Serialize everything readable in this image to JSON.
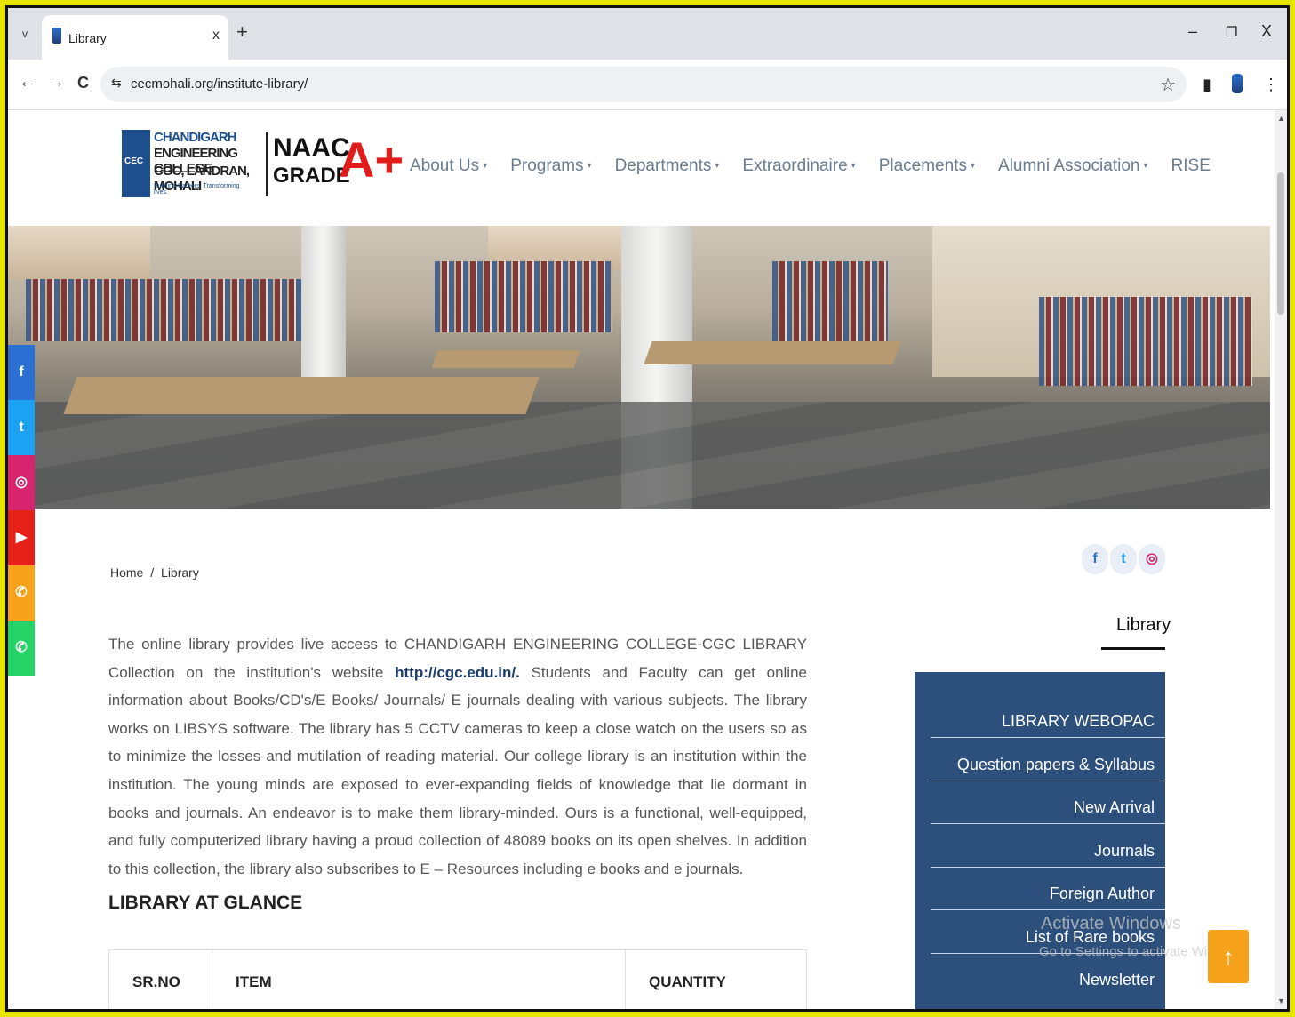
{
  "browser": {
    "tab_title": "Library",
    "tab_close": "x",
    "new_tab": "+",
    "tab_menu": "v",
    "minimize": "–",
    "restore": "❐",
    "close": "X",
    "back": "←",
    "forward": "→",
    "reload": "C",
    "url": "cecmohali.org/institute-library/",
    "site_info_icon": "⇆",
    "star_icon": "☆",
    "side_panel_icon": "▮",
    "menu_icon": "⋮"
  },
  "header": {
    "logo": {
      "line1": "CHANDIGARH",
      "line2": "ENGINEERING COLLEGE",
      "line3": "CGC, LANDRAN, MOHALI",
      "tagline": "Building Careers. Transforming lives.",
      "emblem_text": "CEC"
    },
    "naac": "NAAC",
    "grade": "GRADE",
    "aplus": "A+",
    "nav": [
      {
        "label": "About Us",
        "caret": "▾"
      },
      {
        "label": "Programs",
        "caret": "▾"
      },
      {
        "label": "Departments",
        "caret": "▾"
      },
      {
        "label": "Extraordinaire",
        "caret": "▾"
      },
      {
        "label": "Placements",
        "caret": "▾"
      },
      {
        "label": "Alumni Association",
        "caret": "▾"
      },
      {
        "label": "RISE",
        "caret": ""
      }
    ]
  },
  "social_sidebar": [
    {
      "name": "facebook",
      "glyph": "f",
      "color": "#2a6fd1"
    },
    {
      "name": "twitter",
      "glyph": "t",
      "color": "#1da1f2"
    },
    {
      "name": "instagram",
      "glyph": "◎",
      "color": "#d6246e"
    },
    {
      "name": "youtube",
      "glyph": "▶",
      "color": "#e62117"
    },
    {
      "name": "phone",
      "glyph": "✆",
      "color": "#f7a21b"
    },
    {
      "name": "whatsapp",
      "glyph": "✆",
      "color": "#25d366"
    }
  ],
  "breadcrumb": {
    "home": "Home",
    "sep": "/",
    "current": "Library"
  },
  "intro": {
    "part1": "The online library provides live access to CHANDIGARH ENGINEERING COLLEGE-CGC LIBRARY Collection on the institution's website ",
    "link": "http://cgc.edu.in/.",
    "part2": " Students and Faculty can get online information about Books/CD's/E Books/ Journals/ E journals dealing with various subjects. The library works on LIBSYS software. The library has 5 CCTV cameras to keep a close watch on the users so as to minimize the losses and mutilation of reading material. Our college library is an institution within the institution. The young minds are exposed to ever-expanding fields of knowledge that lie dormant in books and journals. An endeavor is to make them library-minded. Ours is a functional, well-equipped, and fully computerized library having a proud collection of 48089 books on its open shelves. In addition to this collection, the library also subscribes to E – Resources including e books and e journals."
  },
  "glance": {
    "title": "LIBRARY AT GLANCE",
    "columns": [
      "SR.NO",
      "ITEM",
      "QUANTITY"
    ]
  },
  "right_panel": {
    "social": [
      {
        "name": "facebook",
        "glyph": "f",
        "color": "#2a6fd1"
      },
      {
        "name": "twitter",
        "glyph": "t",
        "color": "#1da1f2"
      },
      {
        "name": "instagram",
        "glyph": "◎",
        "color": "#d6246e"
      }
    ],
    "heading": "Library",
    "menu": [
      "LIBRARY WEBOPAC",
      "Question papers & Syllabus",
      "New Arrival",
      "Journals",
      "Foreign Author",
      "List of Rare books",
      "Newsletter"
    ]
  },
  "watermark": {
    "line1": "Activate Windows",
    "line2": "Go to Settings to activate Windows."
  },
  "to_top": "↑",
  "colors": {
    "panel": "#2d4f7c",
    "accent": "#f7a21b",
    "aplus": "#e21b1b"
  }
}
